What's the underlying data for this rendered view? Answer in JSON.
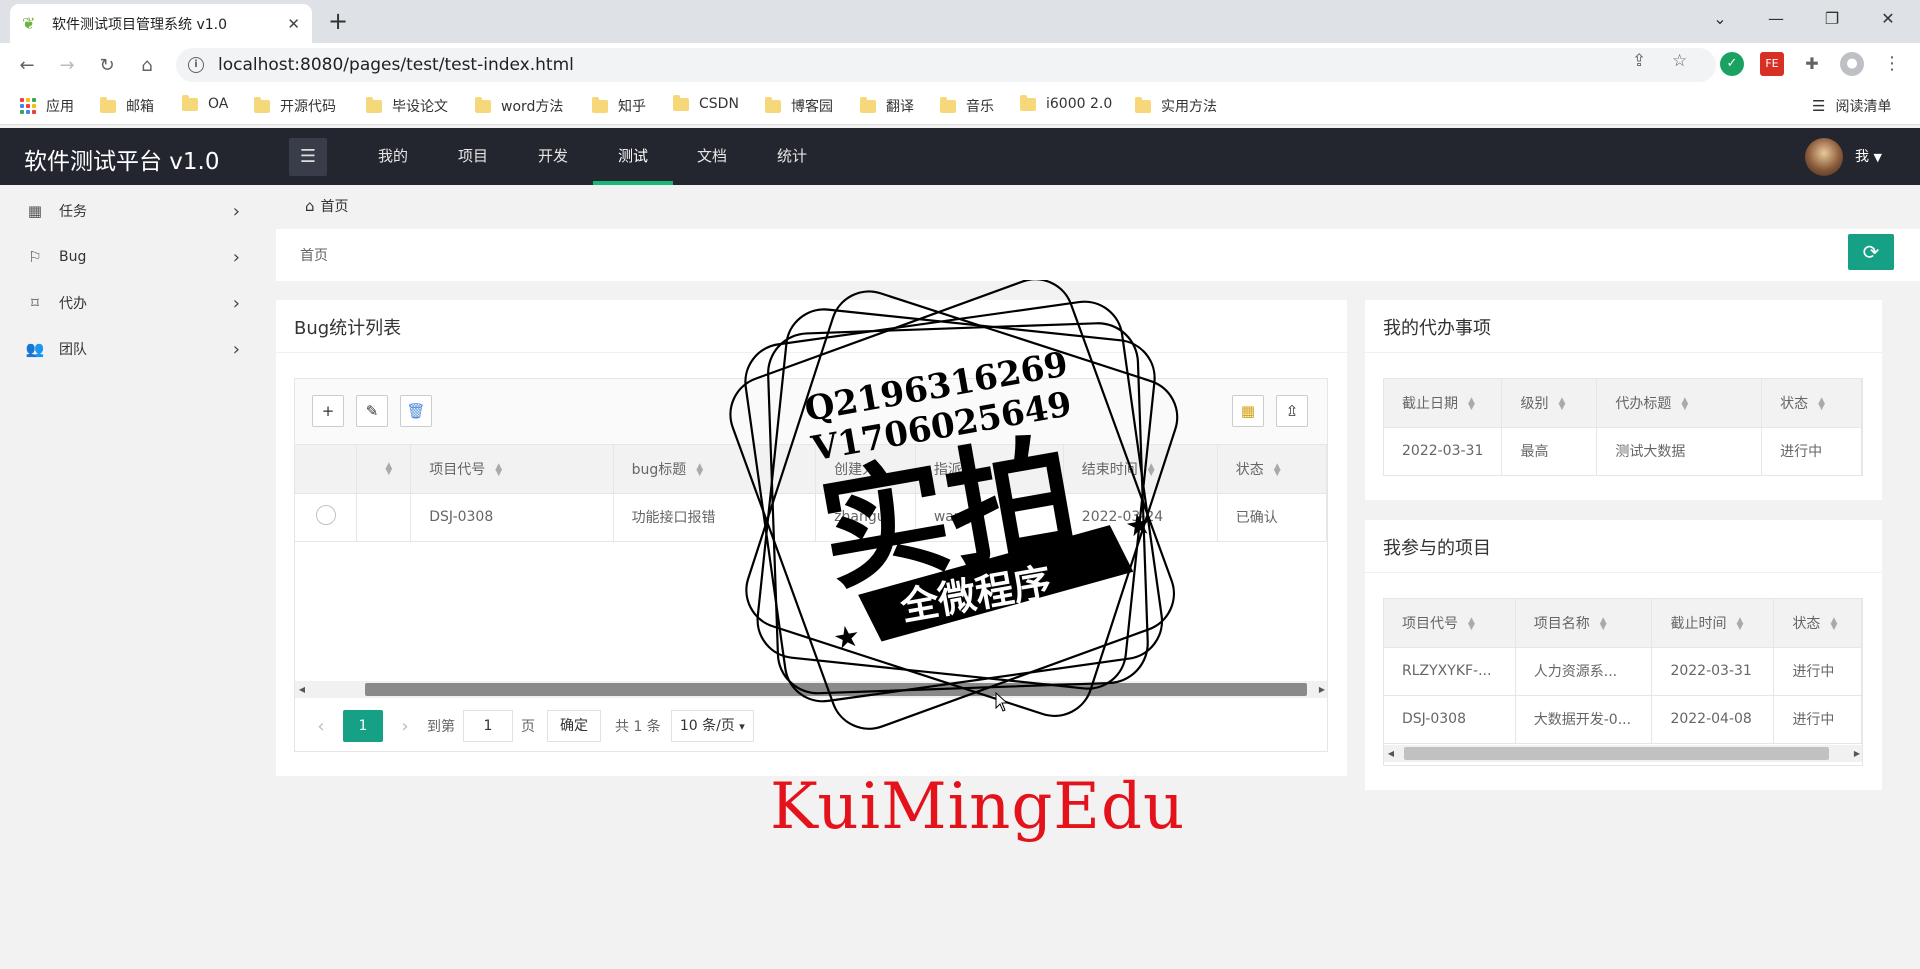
{
  "browser": {
    "tab_title": "软件测试项目管理系统 v1.0",
    "tab_close": "✕",
    "new_tab": "+",
    "url": "localhost:8080/pages/test/test-index.html",
    "bookmarks": [
      "应用",
      "邮箱",
      "OA",
      "开源代码",
      "毕设论文",
      "word方法",
      "知乎",
      "CSDN",
      "博客园",
      "翻译",
      "音乐",
      "i6000 2.0",
      "实用方法"
    ],
    "reading_list": "阅读清单"
  },
  "app": {
    "brand": "软件测试平台 v1.0",
    "nav": [
      "我的",
      "项目",
      "开发",
      "测试",
      "文档",
      "统计"
    ],
    "active_nav": "测试",
    "user": "我",
    "accent": "#16b777"
  },
  "sidebar": {
    "items": [
      {
        "label": "任务",
        "icon": "grid-icon"
      },
      {
        "label": "Bug",
        "icon": "flag-icon"
      },
      {
        "label": "代办",
        "icon": "tag-icon"
      },
      {
        "label": "团队",
        "icon": "users-icon"
      }
    ]
  },
  "breadcrumb": {
    "home": "首页",
    "page": "首页"
  },
  "bug_card": {
    "title": "Bug统计列表",
    "columns": [
      "",
      "",
      "项目代号",
      "bug标题",
      "创建人",
      "指派人",
      "结束时间",
      "状态"
    ],
    "rows": [
      [
        "",
        "",
        "DSJ-0308",
        "功能接口报错",
        "zhangu",
        "wang",
        "2022-03-24",
        "已确认"
      ]
    ],
    "pager": {
      "current": "1",
      "goto_label": "到第",
      "goto_value": "1",
      "page_label": "页",
      "confirm": "确定",
      "total": "共 1 条",
      "per_page": "10 条/页"
    }
  },
  "todo_card": {
    "title": "我的代办事项",
    "columns": [
      "截止日期",
      "级别",
      "代办标题",
      "状态"
    ],
    "rows": [
      [
        "2022-03-31",
        "最高",
        "测试大数据",
        "进行中"
      ]
    ]
  },
  "projects_card": {
    "title": "我参与的项目",
    "columns": [
      "项目代号",
      "项目名称",
      "截止时间",
      "状态"
    ],
    "rows": [
      [
        "RLZYXYKF-...",
        "人力资源系...",
        "2022-03-31",
        "进行中"
      ],
      [
        "DSJ-0308",
        "大数据开发-0...",
        "2022-04-08",
        "进行中"
      ]
    ]
  },
  "overlay": {
    "contact_q": "Q2196316269",
    "contact_v": "V1706025649",
    "stamp_main": "实拍",
    "stamp_sub": "全微程序",
    "watermark": "KuiMingEdu"
  }
}
